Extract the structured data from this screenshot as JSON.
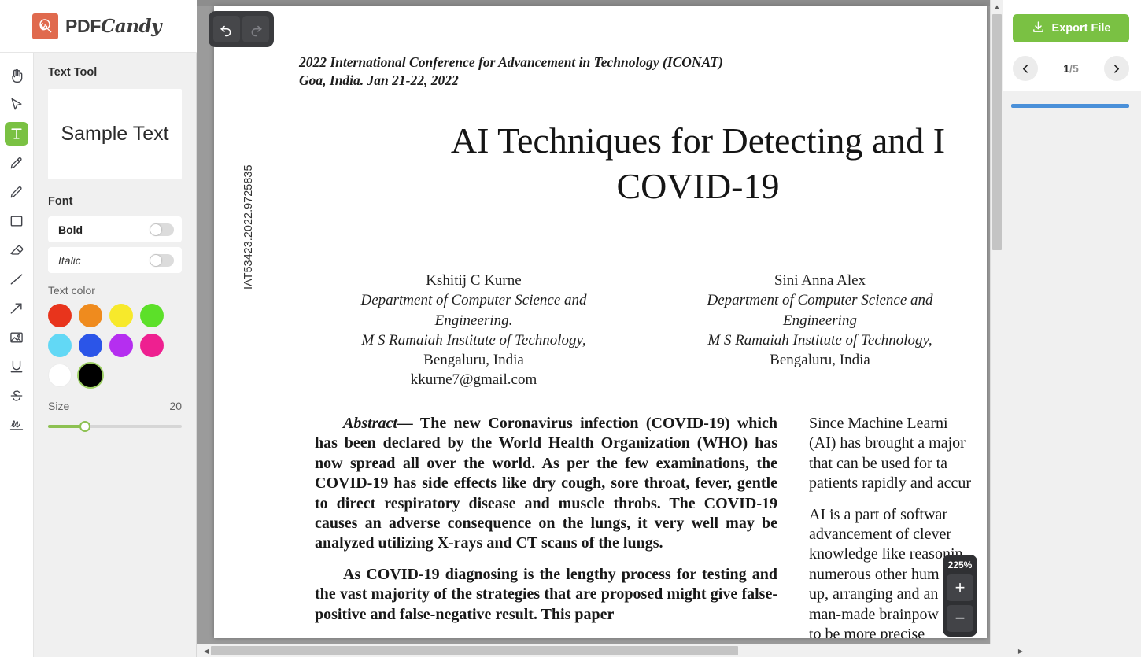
{
  "brand": {
    "name_bold": "PDF",
    "name_script": "Candy",
    "logo_icon": "lollipop-icon",
    "logo_color": "#e06a4e"
  },
  "tools": [
    {
      "id": "hand",
      "icon": "hand-icon",
      "label": "Hand",
      "active": false
    },
    {
      "id": "select",
      "icon": "cursor-icon",
      "label": "Select",
      "active": false
    },
    {
      "id": "text",
      "icon": "text-icon",
      "label": "Text",
      "active": true
    },
    {
      "id": "highlight",
      "icon": "marker-pen-icon",
      "label": "Highlighter",
      "active": false
    },
    {
      "id": "draw",
      "icon": "pencil-icon",
      "label": "Pencil",
      "active": false
    },
    {
      "id": "shape",
      "icon": "rectangle-icon",
      "label": "Rectangle",
      "active": false
    },
    {
      "id": "erase",
      "icon": "eraser-icon",
      "label": "Eraser",
      "active": false
    },
    {
      "id": "line",
      "icon": "line-icon",
      "label": "Line",
      "active": false
    },
    {
      "id": "arrow",
      "icon": "arrow-icon",
      "label": "Arrow",
      "active": false
    },
    {
      "id": "image",
      "icon": "image-icon",
      "label": "Image",
      "active": false
    },
    {
      "id": "underline",
      "icon": "underline-icon",
      "label": "Underline",
      "active": false
    },
    {
      "id": "strike",
      "icon": "strikethrough-icon",
      "label": "Strikethrough",
      "active": false
    },
    {
      "id": "sign",
      "icon": "signature-icon",
      "label": "Signature",
      "active": false
    }
  ],
  "panel": {
    "title": "Text Tool",
    "sample_text": "Sample Text",
    "font_label": "Font",
    "bold_label": "Bold",
    "bold_on": false,
    "italic_label": "Italic",
    "italic_on": false,
    "text_color_label": "Text color",
    "colors": [
      {
        "name": "red",
        "hex": "#e8341c",
        "selected": false
      },
      {
        "name": "orange",
        "hex": "#ef8b1e",
        "selected": false
      },
      {
        "name": "yellow",
        "hex": "#f7e92b",
        "selected": false
      },
      {
        "name": "green",
        "hex": "#5ce029",
        "selected": false
      },
      {
        "name": "cyan",
        "hex": "#62d8f5",
        "selected": false
      },
      {
        "name": "blue",
        "hex": "#2b55e8",
        "selected": false
      },
      {
        "name": "purple",
        "hex": "#b52ef0",
        "selected": false
      },
      {
        "name": "magenta",
        "hex": "#ee2090",
        "selected": false
      },
      {
        "name": "white",
        "hex": "#ffffff",
        "selected": false
      },
      {
        "name": "black",
        "hex": "#000000",
        "selected": true
      }
    ],
    "size_label": "Size",
    "size_value": "20",
    "accent_color": "#8dc152"
  },
  "editor": {
    "undo_label": "Undo",
    "redo_label": "Redo",
    "undo_enabled": true,
    "redo_enabled": false,
    "zoom_level": "225%",
    "zoom_in_label": "+",
    "zoom_out_label": "−"
  },
  "right": {
    "export_label": "Export File",
    "export_icon": "download-icon",
    "export_color": "#7ac143",
    "prev_icon": "chevron-left-icon",
    "next_icon": "chevron-right-icon",
    "current_page": "1",
    "page_separator": "/",
    "total_pages": "5",
    "progress_color": "#4a90d9"
  },
  "document": {
    "doi_vertical": "IAT53423.2022.9725835",
    "conference_line1": "2022 International Conference for Advancement in Technology (ICONAT)",
    "conference_line2": "Goa, India. Jan 21-22, 2022",
    "title_line1": "AI Techniques for Detecting and I",
    "title_line2": "COVID-19",
    "authors": [
      {
        "name": "Kshitij C Kurne",
        "dept_line1": "Department of Computer Science and",
        "dept_line2": "Engineering.",
        "institute": "M S Ramaiah Institute of Technology,",
        "city": "Bengaluru, India",
        "email": "kkurne7@gmail.com"
      },
      {
        "name": "Sini Anna Alex",
        "dept_line1": "Department of Computer Science and",
        "dept_line2": "Engineering",
        "institute": "M S Ramaiah Institute of Technology,",
        "city": "Bengaluru, India",
        "email": ""
      }
    ],
    "abstract_label": "Abstract—",
    "abstract_body": " The new Coronavirus infection (COVID-19) which has been declared by the World Health Organization (WHO) has now spread all over the world. As per the few examinations, the COVID-19 has side effects like dry cough, sore throat, fever, gentle to direct respiratory disease and muscle throbs. The COVID-19 causes an adverse consequence on the lungs, it very well may be analyzed utilizing X-rays and CT scans of the lungs.",
    "left_paragraph2": "As COVID-19 diagnosing is the lengthy process for testing and the vast majority of the strategies that are proposed might give false-positive and false-negative result. This paper",
    "right_column_lines": [
      "    Since Machine Learni",
      "(AI) has brought a major",
      "that can be used for ta",
      "patients rapidly and accur",
      "",
      "    AI is a part of softwar",
      "advancement  of  clever",
      "knowledge  like  reasonin",
      "numerous other hum",
      "up, arranging and an",
      "man-made brainpow",
      "to be more precise"
    ]
  }
}
